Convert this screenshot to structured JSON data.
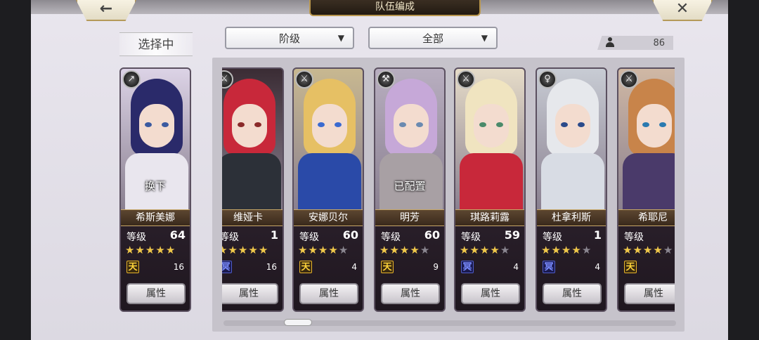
{
  "header": {
    "title": "队伍编成",
    "back_icon": "←",
    "close_icon": "✕"
  },
  "selected_label": "选择中",
  "filters": {
    "rank": "阶级",
    "type": "全部",
    "arrow": "▼"
  },
  "roster_count": "86",
  "attr_label": "属性",
  "level_label": "等级",
  "colors": {
    "gold": "#c7a766",
    "star_on": "#f0c84a",
    "star_off": "#8a8690"
  },
  "selected_card": {
    "name": "希斯美娜",
    "level": "64",
    "stars": 5,
    "element": "天",
    "element_type": "sky",
    "count": "16",
    "overlay": "换下",
    "class_icon": "↗"
  },
  "cards": [
    {
      "name": "维娅卡",
      "level": "1",
      "stars": 5,
      "element": "冥",
      "element_type": "dark",
      "count": "16",
      "overlay": "",
      "class_icon": "⚔"
    },
    {
      "name": "安娜贝尔",
      "level": "60",
      "stars": 4,
      "element": "天",
      "element_type": "sky",
      "count": "4",
      "overlay": "",
      "class_icon": "⚔"
    },
    {
      "name": "明芳",
      "level": "60",
      "stars": 4,
      "element": "天",
      "element_type": "sky",
      "count": "9",
      "overlay": "已配置",
      "class_icon": "⚒"
    },
    {
      "name": "琪路莉露",
      "level": "59",
      "stars": 4,
      "element": "冥",
      "element_type": "dark",
      "count": "4",
      "overlay": "",
      "class_icon": "⚔"
    },
    {
      "name": "杜拿利斯",
      "level": "1",
      "stars": 4,
      "element": "冥",
      "element_type": "dark",
      "count": "4",
      "overlay": "",
      "class_icon": "♀"
    },
    {
      "name": "希耶尼",
      "level": "",
      "stars": 4,
      "element": "天",
      "element_type": "sky",
      "count": "",
      "overlay": "",
      "class_icon": "⚔"
    }
  ]
}
